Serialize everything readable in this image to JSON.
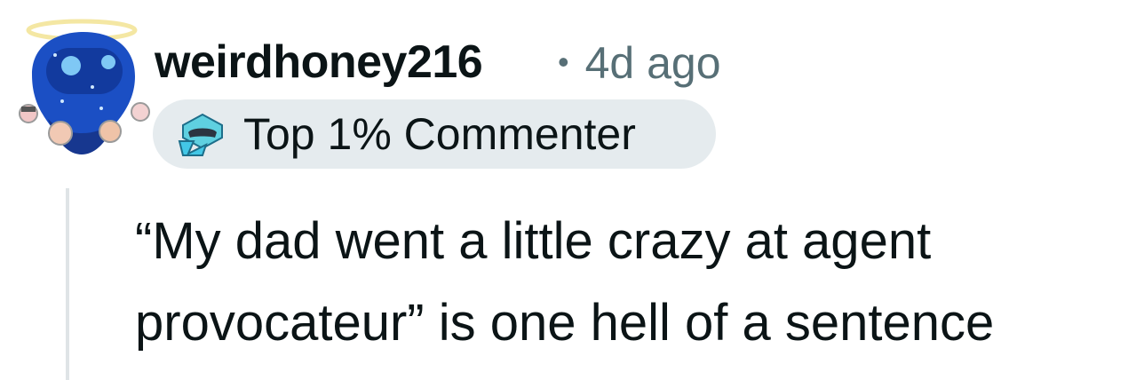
{
  "comment": {
    "username": "weirdhoney216",
    "separator": "•",
    "timestamp": "4d ago",
    "flair": {
      "icon": "commenter-badge-icon",
      "label": "Top 1% Commenter"
    },
    "body": "“My dad went a little crazy at agent provocateur” is one hell of a sentence"
  },
  "avatar": {
    "icon": "halo-avatar-icon",
    "colors": {
      "body": "#1b4fc4",
      "halo": "#f7e9a6",
      "face": "#0f2a86"
    }
  },
  "colors": {
    "text": "#0b1416",
    "meta": "#576f76",
    "flair_bg": "#e5ebee",
    "thread_line": "#dfe4e6"
  }
}
